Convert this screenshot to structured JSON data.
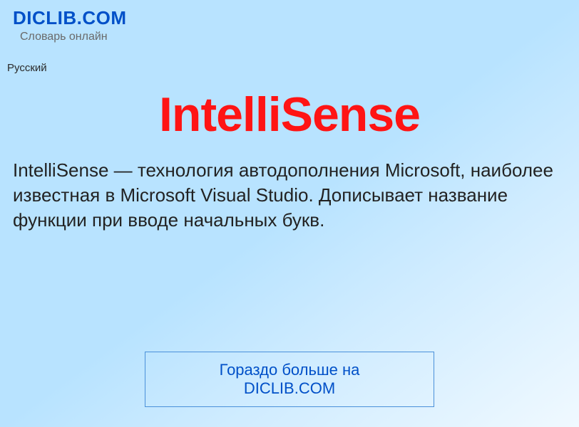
{
  "header": {
    "logo": "DICLIB.COM",
    "tagline": "Словарь онлайн",
    "language": "Русский"
  },
  "article": {
    "title": "IntelliSense",
    "description": "IntelliSense — технология автодополнения Microsoft, наиболее известная в Microsoft Visual Studio. Дописывает название функции при вводе начальных букв."
  },
  "footer": {
    "button_label": "Гораздо больше на DICLIB.COM"
  }
}
